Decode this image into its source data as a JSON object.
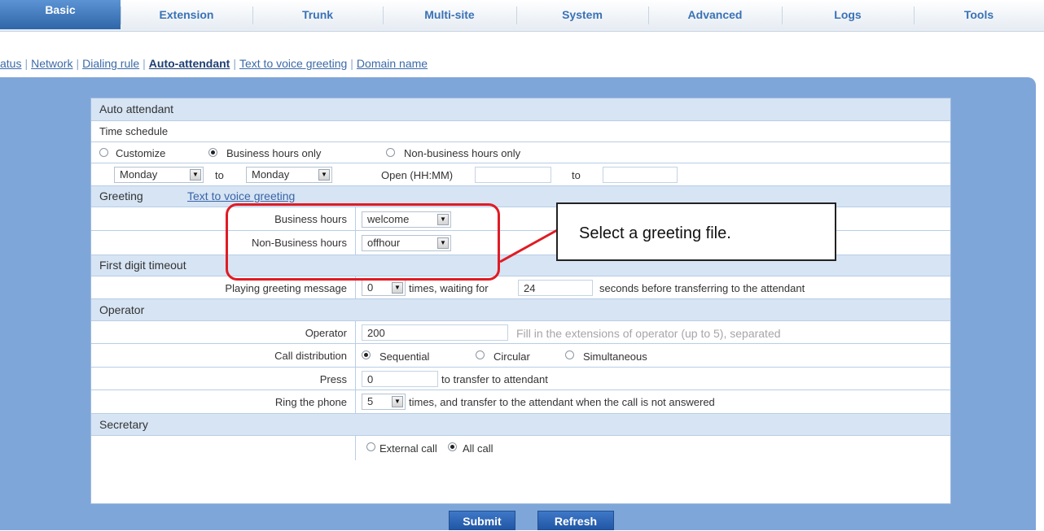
{
  "nav": {
    "tabs": [
      "Basic",
      "Extension",
      "Trunk",
      "Multi-site",
      "System",
      "Advanced",
      "Logs",
      "Tools"
    ],
    "active": "Basic"
  },
  "subnav": {
    "items": [
      "atus",
      "Network",
      "Dialing rule",
      "Auto-attendant",
      "Text to voice greeting",
      "Domain name"
    ],
    "current": "Auto-attendant"
  },
  "form": {
    "section_title": "Auto attendant",
    "time_schedule": {
      "label": "Time schedule",
      "options": [
        "Customize",
        "Business hours only",
        "Non-business hours only"
      ],
      "selected": "Business hours only",
      "from_day": "Monday",
      "to_label": "to",
      "to_day": "Monday",
      "open_label": "Open (HH:MM)",
      "open_value": "",
      "open_to_label": "to",
      "close_value": ""
    },
    "greeting": {
      "label": "Greeting",
      "link": "Text to voice greeting",
      "business_hours_label": "Business hours",
      "business_hours_value": "welcome",
      "non_business_hours_label": "Non-Business hours",
      "non_business_hours_value": "offhour"
    },
    "first_digit": {
      "label": "First digit timeout",
      "playing_label": "Playing greeting message",
      "times_value": "0",
      "times_text": "times, waiting for",
      "wait_value": "24",
      "wait_text": "seconds before transferring to the attendant"
    },
    "operator": {
      "label": "Operator",
      "operator_label": "Operator",
      "operator_value": "200",
      "operator_hint": "Fill in the extensions of operator (up to 5), separated",
      "distribution_label": "Call distribution",
      "distribution_options": [
        "Sequential",
        "Circular",
        "Simultaneous"
      ],
      "distribution_selected": "Sequential",
      "press_label": "Press",
      "press_value": "0",
      "press_text": "to transfer to attendant",
      "ring_label": "Ring the phone",
      "ring_value": "5",
      "ring_text": "times, and transfer to the attendant when the call is not answered"
    },
    "secretary": {
      "label": "Secretary",
      "options": [
        "External call",
        "All call"
      ],
      "selected": "All call"
    }
  },
  "callout": {
    "text": "Select a greeting file."
  },
  "buttons": {
    "submit": "Submit",
    "refresh": "Refresh"
  },
  "colors": {
    "nav_active": "#2f66a8",
    "header_row": "#d6e4f4",
    "highlight": "#e01b24"
  }
}
